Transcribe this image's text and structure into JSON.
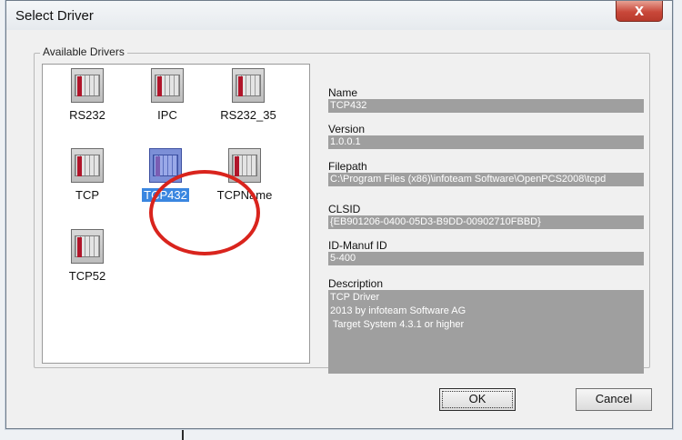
{
  "window": {
    "title": "Select Driver",
    "close_label": "x"
  },
  "group": {
    "label": "Available Drivers"
  },
  "drivers": [
    {
      "label": "RS232"
    },
    {
      "label": "IPC"
    },
    {
      "label": "RS232_35"
    },
    {
      "label": "TCP"
    },
    {
      "label": "TCP432"
    },
    {
      "label": "TCPName"
    },
    {
      "label": "TCP52"
    }
  ],
  "selected_driver": "TCP432",
  "details": {
    "name_label": "Name",
    "name_value": "TCP432",
    "version_label": "Version",
    "version_value": "1.0.0.1",
    "filepath_label": "Filepath",
    "filepath_value": "C:\\Program Files (x86)\\infoteam Software\\OpenPCS2008\\tcpd",
    "clsid_label": "CLSID",
    "clsid_value": "{EB901206-0400-05D3-B9DD-00902710FBBD}",
    "idmanuf_label": "ID-Manuf ID",
    "idmanuf_value": "5-400",
    "description_label": "Description",
    "description_value": "TCP Driver\n2013 by infoteam Software AG\n Target System 4.3.1 or higher"
  },
  "buttons": {
    "ok": "OK",
    "cancel": "Cancel"
  },
  "colors": {
    "highlight_circle": "#d9241d",
    "selection": "#3a86e0",
    "value_bg": "#9f9f9f"
  }
}
